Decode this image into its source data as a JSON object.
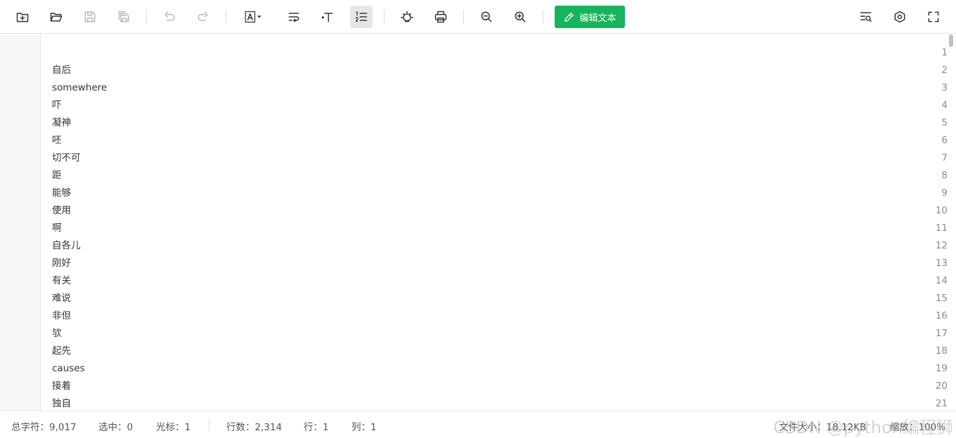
{
  "toolbar": {
    "icons": [
      "new-file-icon",
      "open-folder-icon",
      "save-icon",
      "save-as-icon",
      "undo-icon",
      "redo-icon",
      "font-icon",
      "wrap-icon",
      "text-style-icon",
      "line-numbers-icon",
      "theme-icon",
      "print-icon",
      "zoom-out-icon",
      "zoom-in-icon",
      "search-icon",
      "settings-icon",
      "fullscreen-icon"
    ],
    "edit_label": "编辑文本",
    "accent": "#18b45b"
  },
  "editor": {
    "lines": [
      {
        "num": "1",
        "text": ""
      },
      {
        "num": "2",
        "text": "自后"
      },
      {
        "num": "3",
        "text": "somewhere"
      },
      {
        "num": "4",
        "text": "吓"
      },
      {
        "num": "5",
        "text": "凝神"
      },
      {
        "num": "6",
        "text": "呸"
      },
      {
        "num": "7",
        "text": "切不可"
      },
      {
        "num": "8",
        "text": "距"
      },
      {
        "num": "9",
        "text": "能够"
      },
      {
        "num": "10",
        "text": "使用"
      },
      {
        "num": "11",
        "text": "啊"
      },
      {
        "num": "12",
        "text": "自各儿"
      },
      {
        "num": "13",
        "text": "刚好"
      },
      {
        "num": "14",
        "text": "有关"
      },
      {
        "num": "15",
        "text": "难说"
      },
      {
        "num": "16",
        "text": "非但"
      },
      {
        "num": "17",
        "text": "欤"
      },
      {
        "num": "18",
        "text": "起先"
      },
      {
        "num": "19",
        "text": "causes"
      },
      {
        "num": "20",
        "text": "接着"
      },
      {
        "num": "21",
        "text": "独自"
      }
    ]
  },
  "status": {
    "total_chars": "总字符：9,017",
    "selected": "选中：0",
    "cursor": "光标：1",
    "lines": "行数：2,314",
    "row": "行：1",
    "col": "列：1",
    "file_size": "文件大小：18.12KB",
    "zoom": "缩放：100%",
    "watermark": "CSDN @python编程狮"
  }
}
